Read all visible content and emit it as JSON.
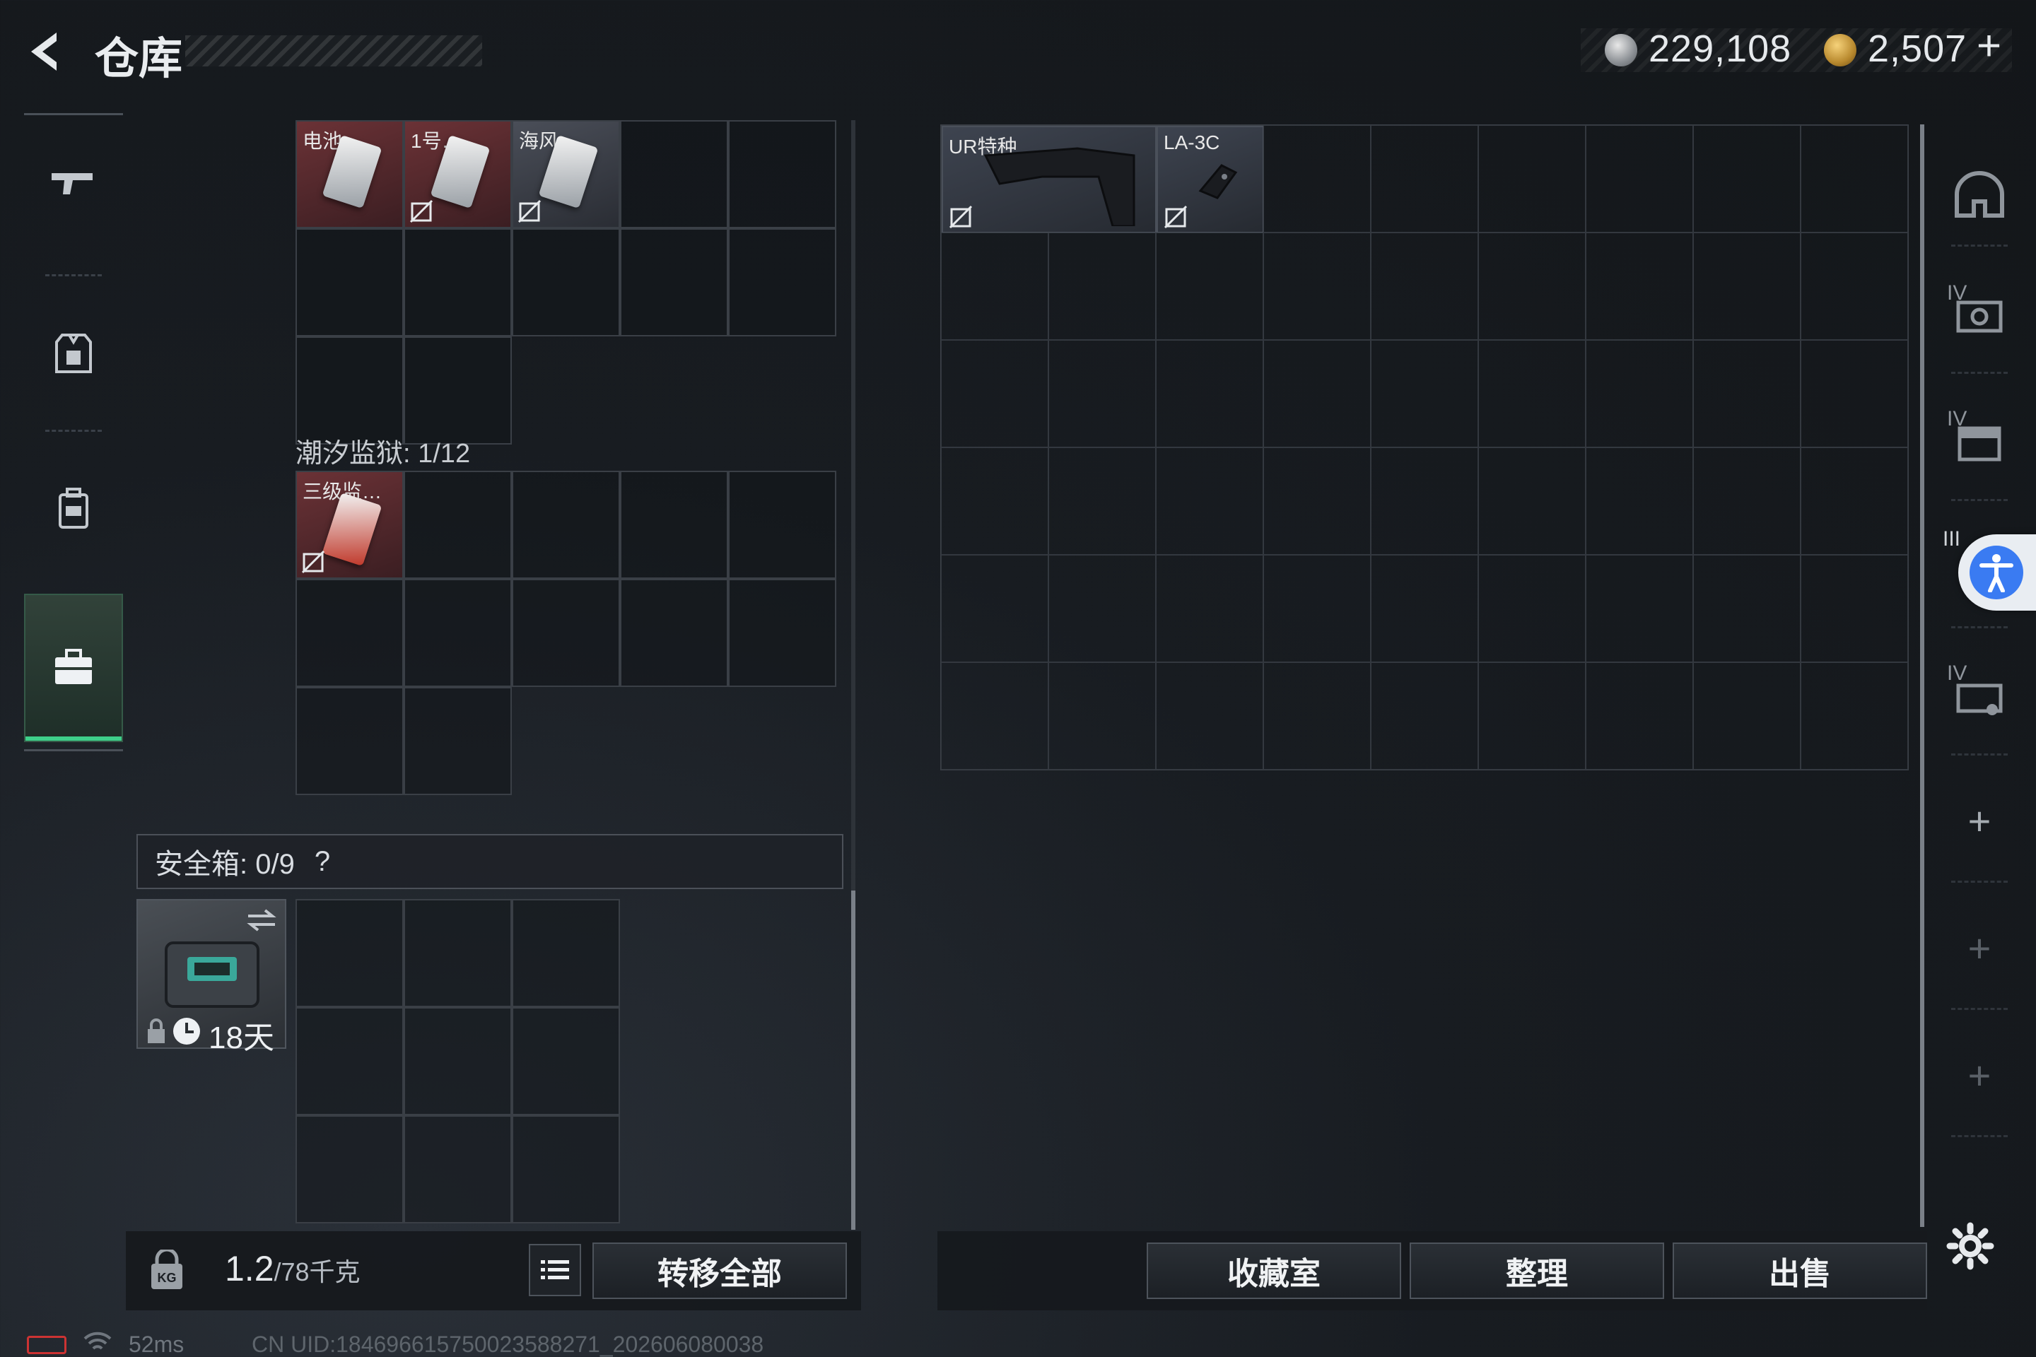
{
  "header": {
    "title": "仓库",
    "currency_silver": "229,108",
    "currency_gold": "2,507",
    "add_label": "+"
  },
  "left_panel": {
    "top_items": [
      {
        "label": "电池…"
      },
      {
        "label": "1号…"
      },
      {
        "label": "海风…"
      }
    ],
    "prison_section": "潮汐监狱: 1/12",
    "prison_item": {
      "label": "三级监…"
    },
    "safe_box_label": "安全箱: 0/9",
    "safe_box_help": "?",
    "safe_box_duration": "18天"
  },
  "right_panel": {
    "items": [
      {
        "label": "UR特种"
      },
      {
        "label": "LA-3C"
      }
    ]
  },
  "side_tools": {
    "slot_labels": [
      "IV",
      "IV",
      "III",
      "IV"
    ],
    "add_labels": [
      "+",
      "+",
      "+"
    ]
  },
  "bottom": {
    "weight_value": "1.2",
    "weight_max": "/78千克",
    "transfer_all": "转移全部",
    "collection": "收藏室",
    "organize": "整理",
    "sell": "出售"
  },
  "status": {
    "ping": "52ms",
    "uid": "CN UID:184696615750023588271_202606080038"
  },
  "colors": {
    "accent_green": "#3ed08a",
    "accessibility_blue": "#3a7bf2",
    "item_red": "#6b3236"
  }
}
